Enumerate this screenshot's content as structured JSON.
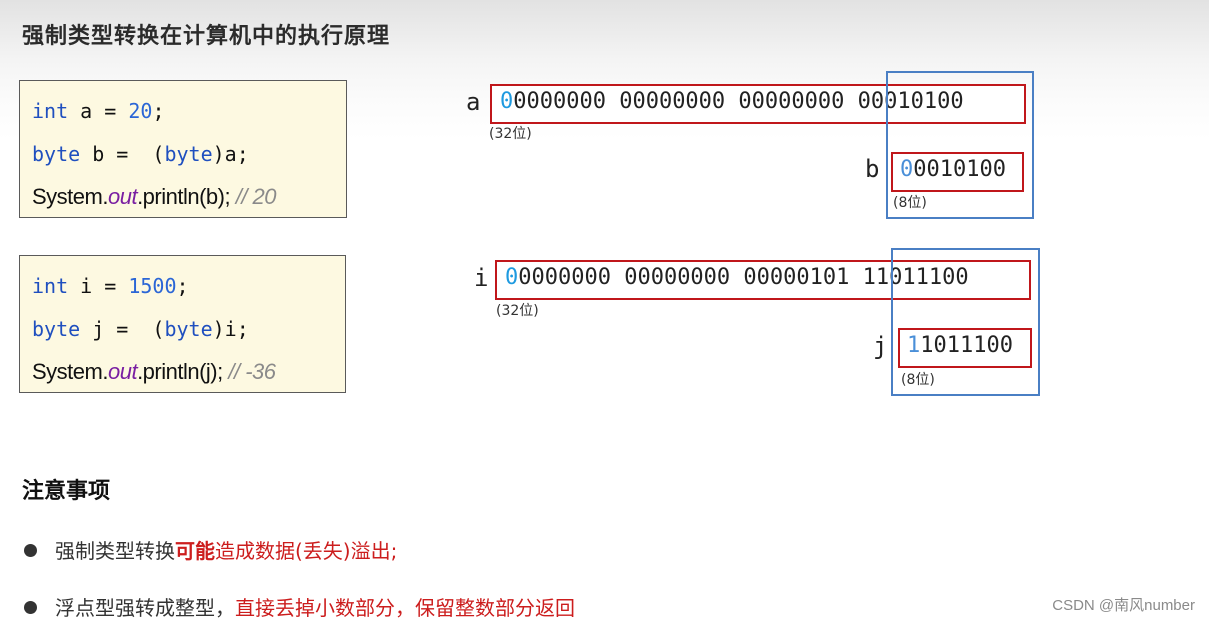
{
  "title": "强制类型转换在计算机中的执行原理",
  "example1": {
    "code": {
      "line1": {
        "kw": "int",
        "rest": " a = ",
        "num": "20",
        "end": ";"
      },
      "line2": {
        "kw": "byte",
        "rest": " b =  (",
        "kw2": "byte",
        "end": ")a;"
      },
      "line3": {
        "pre": "System.",
        "out": "out",
        "post": ".println(b); ",
        "comment": "// 20"
      }
    },
    "diagram": {
      "src_label": "a",
      "src_first_bit": "0",
      "src_rest_bits": "0000000 00000000 00000000 00010100",
      "src_note": "(32位)",
      "dst_label": "b",
      "dst_first_bit": "0",
      "dst_rest_bits": "0010100",
      "dst_note": "(8位)"
    }
  },
  "example2": {
    "code": {
      "line1": {
        "kw": "int",
        "rest": " i = ",
        "num": "1500",
        "end": ";"
      },
      "line2": {
        "kw": "byte",
        "rest": " j =  (",
        "kw2": "byte",
        "end": ")i;"
      },
      "line3": {
        "pre": "System.",
        "out": "out",
        "post": ".println(j); ",
        "comment": "// -36"
      }
    },
    "diagram": {
      "src_label": "i",
      "src_first_bit": "0",
      "src_rest_bits": "0000000 00000000 00000101 11011100",
      "src_note": "(32位)",
      "dst_label": "j",
      "dst_first_bit": "1",
      "dst_rest_bits": "1011100",
      "dst_note": "(8位)"
    }
  },
  "notes": {
    "title": "注意事项",
    "items": [
      {
        "plain": "强制类型转换",
        "bold_red": "可能",
        "red": "造成数据(丢失)溢出;"
      },
      {
        "plain": "浮点型强转成整型，",
        "bold_red": "",
        "red": "直接丢掉小数部分，保留整数部分返回"
      }
    ]
  },
  "colors": {
    "red_box": "#c0171b",
    "blue_box": "#4a7fc4",
    "code_bg": "#fdf9e1",
    "keyword": "#1f4fbf",
    "highlight_bit": "#1e9ae0",
    "emphasis": "#cc1d1d"
  },
  "watermark": "CSDN @南风number"
}
